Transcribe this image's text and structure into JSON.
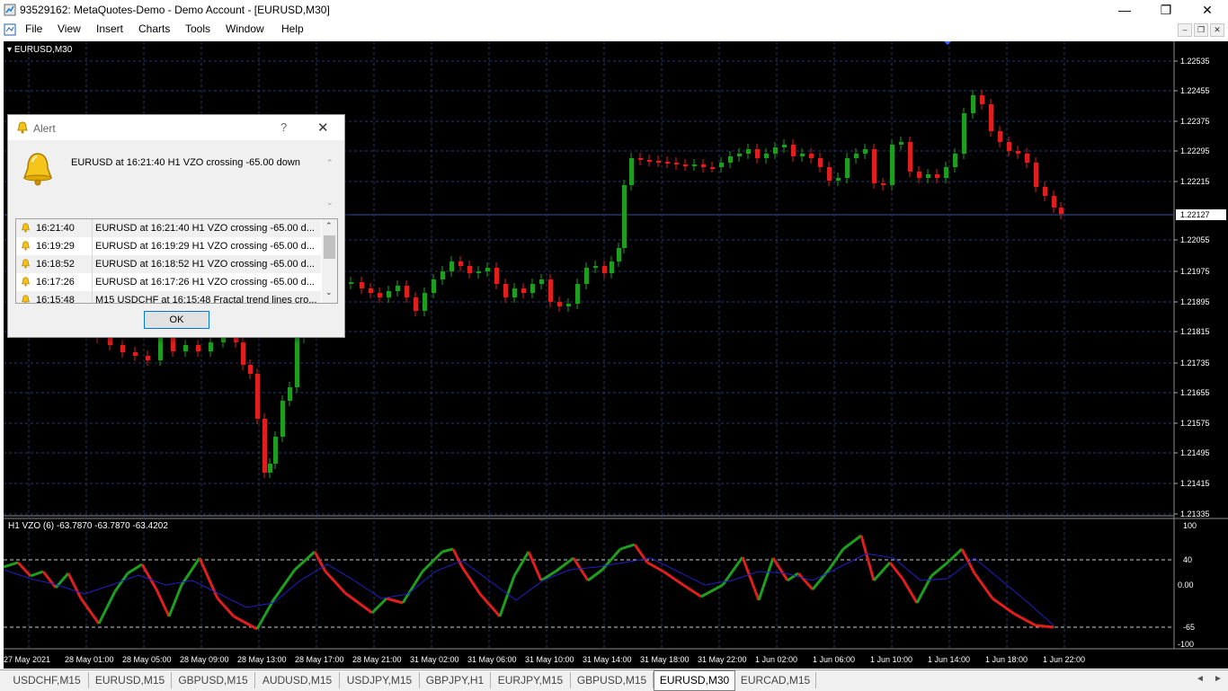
{
  "window": {
    "title": "93529162: MetaQuotes-Demo - Demo Account - [EURUSD,M30]",
    "minimize": "—",
    "maximize": "❐",
    "close": "✕"
  },
  "menu": {
    "items": [
      "File",
      "View",
      "Insert",
      "Charts",
      "Tools",
      "Window",
      "Help"
    ]
  },
  "chart": {
    "symbol_label": "EURUSD,M30",
    "price_labels": [
      "1.22535",
      "1.22455",
      "1.22375",
      "1.22295",
      "1.22215",
      "1.22055",
      "1.21975",
      "1.21895",
      "1.21815",
      "1.21735",
      "1.21655",
      "1.21575",
      "1.21495",
      "1.21415",
      "1.21335"
    ],
    "current_price": "1.22127",
    "indicator_label": "H1 VZO (6) -63.7870 -63.7870 -63.4202",
    "indicator_levels": [
      "100",
      "40",
      "0.00",
      "-65",
      "-100"
    ],
    "time_labels": [
      "27 May 2021",
      "28 May 01:00",
      "28 May 05:00",
      "28 May 09:00",
      "28 May 13:00",
      "28 May 17:00",
      "28 May 21:00",
      "31 May 02:00",
      "31 May 06:00",
      "31 May 10:00",
      "31 May 14:00",
      "31 May 18:00",
      "31 May 22:00",
      "1 Jun 02:00",
      "1 Jun 06:00",
      "1 Jun 10:00",
      "1 Jun 14:00",
      "1 Jun 18:00",
      "1 Jun 22:00"
    ],
    "colors": {
      "bull": "#1e9e1e",
      "bear": "#e01e1e",
      "background": "#000000",
      "grid": "#2a3a6a"
    }
  },
  "alert": {
    "title": "Alert",
    "help": "?",
    "close": "✕",
    "message": "EURUSD at 16:21:40 H1 VZO  crossing -65.00 down",
    "rows": [
      {
        "time": "16:21:40",
        "text": "EURUSD at 16:21:40 H1 VZO  crossing -65.00 d..."
      },
      {
        "time": "16:19:29",
        "text": "EURUSD at 16:19:29 H1 VZO  crossing -65.00 d..."
      },
      {
        "time": "16:18:52",
        "text": "EURUSD at 16:18:52 H1 VZO  crossing -65.00 d..."
      },
      {
        "time": "16:17:26",
        "text": "EURUSD at 16:17:26 H1 VZO  crossing -65.00 d..."
      },
      {
        "time": "16:15:48",
        "text": "M15 USDCHF at 16:15:48 Fractal trend lines cro..."
      }
    ],
    "ok": "OK"
  },
  "tabs": {
    "items": [
      "USDCHF,M15",
      "EURUSD,M15",
      "GBPUSD,M15",
      "AUDUSD,M15",
      "USDJPY,M15",
      "GBPJPY,H1",
      "EURJPY,M15",
      "GBPUSD,M15",
      "EURUSD,M30",
      "EURCAD,M15"
    ],
    "active": "EURUSD,M30",
    "scroll_left": "◄",
    "scroll_right": "►"
  }
}
